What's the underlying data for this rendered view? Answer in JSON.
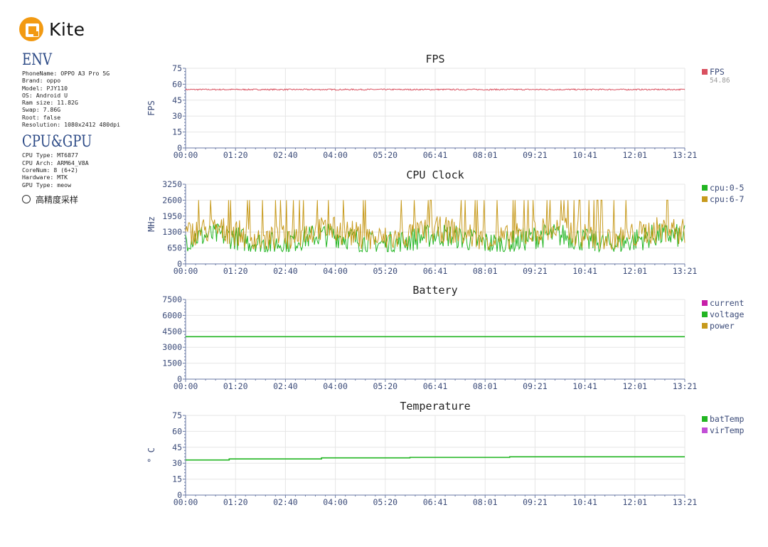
{
  "brand": {
    "name": "Kite",
    "color": "#f29a12"
  },
  "env": {
    "title": "ENV",
    "lines": [
      "PhoneName: OPPO A3 Pro 5G",
      "Brand: oppo",
      "Model: PJY110",
      "OS: Android U",
      "Ram size: 11.82G",
      "Swap: 7.86G",
      "Root: false",
      "Resolution: 1080x2412 480dpi"
    ]
  },
  "cpu_gpu": {
    "title": "CPU&GPU",
    "lines": [
      "CPU Type: MT6877",
      "CPU Arch: ARM64_V8A",
      "CoreNum: 8 (6+2)",
      "Hardware: MTK",
      "GPU Type: meow"
    ]
  },
  "sampling": {
    "label": "高精度采样",
    "checked": false
  },
  "chart_data": [
    {
      "type": "line",
      "title": "FPS",
      "ylabel": "FPS",
      "ylim": [
        0,
        75
      ],
      "yticks": [
        "0",
        "15",
        "30",
        "45",
        "60",
        "75"
      ],
      "xticks": [
        "00:00",
        "01:20",
        "02:40",
        "04:00",
        "05:20",
        "06:41",
        "08:01",
        "09:21",
        "10:41",
        "12:01",
        "13:21"
      ],
      "x_range_minutes": [
        0,
        801
      ],
      "grid": true,
      "legend_position": "right",
      "series": [
        {
          "name": "FPS",
          "color": "#d9505f",
          "legend_value": "54.86",
          "kind": "noise",
          "base": 55,
          "amp": 0.6,
          "swing": 0
        }
      ]
    },
    {
      "type": "line",
      "title": "CPU Clock",
      "ylabel": "MHz",
      "ylim": [
        0,
        3250
      ],
      "yticks": [
        "0",
        "650",
        "1300",
        "1950",
        "2600",
        "3250"
      ],
      "xticks": [
        "00:00",
        "01:20",
        "02:40",
        "04:00",
        "05:20",
        "06:41",
        "08:01",
        "09:21",
        "10:41",
        "12:01",
        "13:21"
      ],
      "x_range_minutes": [
        0,
        801
      ],
      "grid": true,
      "legend_position": "right",
      "series": [
        {
          "name": "cpu:0-5",
          "color": "#22b522",
          "kind": "spiky",
          "base": 1000,
          "amp": 500,
          "low": 500,
          "high": 2000,
          "spike": 0
        },
        {
          "name": "cpu:6-7",
          "color": "#c79a1c",
          "kind": "spiky",
          "base": 1200,
          "amp": 550,
          "low": 600,
          "high": 2600,
          "spike": 0.12
        }
      ]
    },
    {
      "type": "line",
      "title": "Battery",
      "ylabel": "",
      "ylim": [
        0,
        7500
      ],
      "yticks": [
        "0",
        "1500",
        "3000",
        "4500",
        "6000",
        "7500"
      ],
      "xticks": [
        "00:00",
        "01:20",
        "02:40",
        "04:00",
        "05:20",
        "06:41",
        "08:01",
        "09:21",
        "10:41",
        "12:01",
        "13:21"
      ],
      "x_range_minutes": [
        0,
        801
      ],
      "grid": true,
      "legend_position": "right",
      "series": [
        {
          "name": "current",
          "color": "#c71fa8",
          "kind": "none"
        },
        {
          "name": "voltage",
          "color": "#22b522",
          "kind": "steps",
          "steps": [
            [
              0,
              4000
            ],
            [
              801,
              4000
            ]
          ]
        },
        {
          "name": "power",
          "color": "#c79a1c",
          "kind": "none"
        }
      ]
    },
    {
      "type": "line",
      "title": "Temperature",
      "ylabel": "° C",
      "ylim": [
        0,
        75
      ],
      "yticks": [
        "0",
        "15",
        "30",
        "45",
        "60",
        "75"
      ],
      "xticks": [
        "00:00",
        "01:20",
        "02:40",
        "04:00",
        "05:20",
        "06:41",
        "08:01",
        "09:21",
        "10:41",
        "12:01",
        "13:21"
      ],
      "x_range_minutes": [
        0,
        801
      ],
      "grid": true,
      "legend_position": "right",
      "series": [
        {
          "name": "batTemp",
          "color": "#22b522",
          "kind": "steps",
          "steps": [
            [
              0,
              33
            ],
            [
              70,
              34
            ],
            [
              218,
              35
            ],
            [
              360,
              35.5
            ],
            [
              520,
              36
            ],
            [
              801,
              36
            ]
          ]
        },
        {
          "name": "virTemp",
          "color": "#c24fd6",
          "kind": "none"
        }
      ]
    }
  ]
}
